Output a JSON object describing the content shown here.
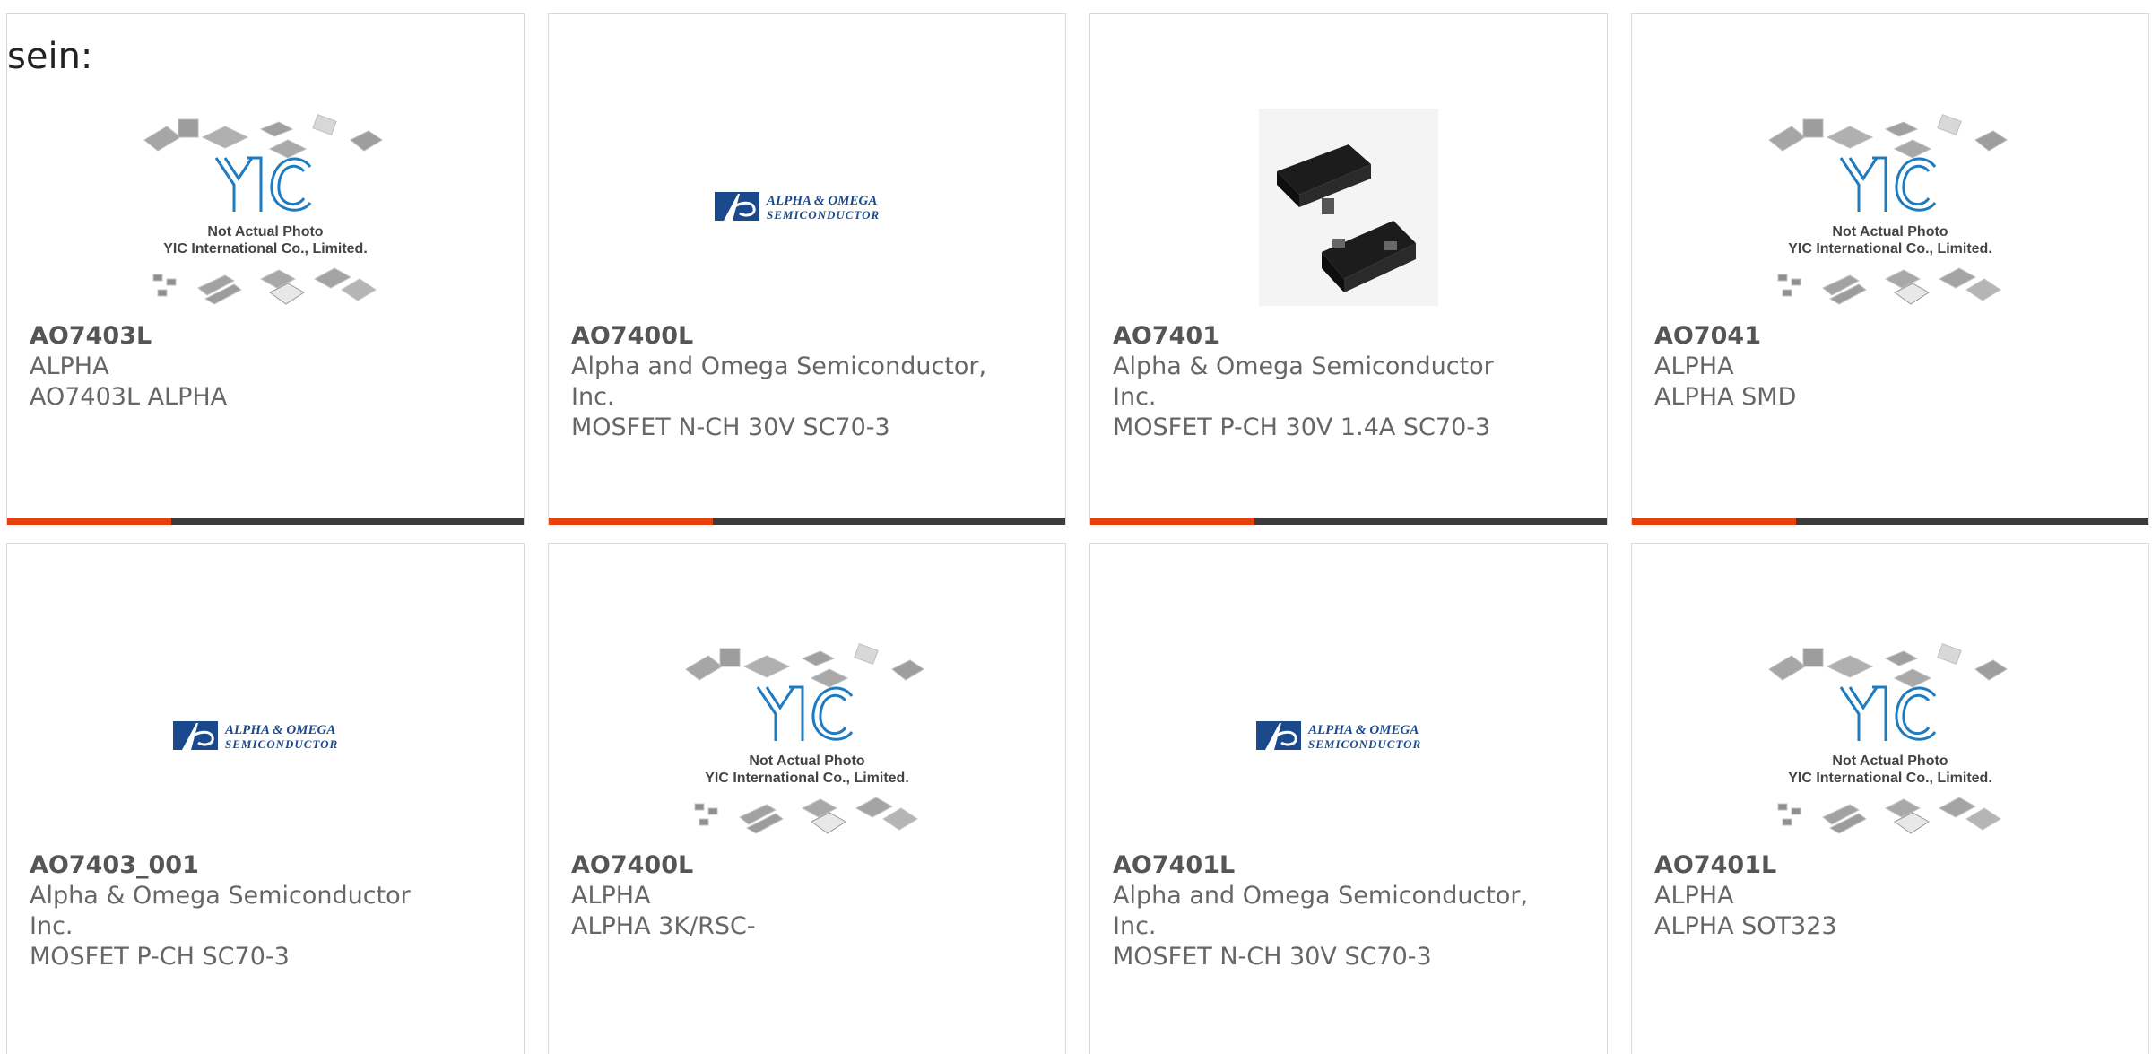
{
  "lead_text": "sein:",
  "placeholder": {
    "line1": "Not Actual Photo",
    "line2": "YIC International Co., Limited."
  },
  "ao_logo": {
    "line1": "ALPHA & OMEGA",
    "line2": "SEMICONDUCTOR"
  },
  "colors": {
    "accent": "#e8400c",
    "bar": "#3b3b3b",
    "logo_blue": "#1b4a8c"
  },
  "products": [
    {
      "part": "AO7403L",
      "maker": "ALPHA",
      "maker2": "",
      "desc": "AO7403L ALPHA",
      "image": "yic-placeholder"
    },
    {
      "part": "AO7400L",
      "maker": "Alpha and Omega Semiconductor,",
      "maker2": "Inc.",
      "desc": "MOSFET N-CH 30V SC70-3",
      "image": "ao-logo"
    },
    {
      "part": "AO7401",
      "maker": "Alpha & Omega Semiconductor",
      "maker2": "Inc.",
      "desc": "MOSFET P-CH 30V 1.4A SC70-3",
      "image": "chip-photo"
    },
    {
      "part": "AO7041",
      "maker": "ALPHA",
      "maker2": "",
      "desc": "ALPHA SMD",
      "image": "yic-placeholder"
    },
    {
      "part": "AO7403_001",
      "maker": "Alpha & Omega Semiconductor",
      "maker2": "Inc.",
      "desc": "MOSFET P-CH SC70-3",
      "image": "ao-logo"
    },
    {
      "part": "AO7400L",
      "maker": "ALPHA",
      "maker2": "",
      "desc": "ALPHA 3K/RSC-",
      "image": "yic-placeholder"
    },
    {
      "part": "AO7401L",
      "maker": "Alpha and Omega Semiconductor,",
      "maker2": "Inc.",
      "desc": "MOSFET N-CH 30V SC70-3",
      "image": "ao-logo"
    },
    {
      "part": "AO7401L",
      "maker": "ALPHA",
      "maker2": "",
      "desc": "ALPHA SOT323",
      "image": "yic-placeholder"
    }
  ]
}
